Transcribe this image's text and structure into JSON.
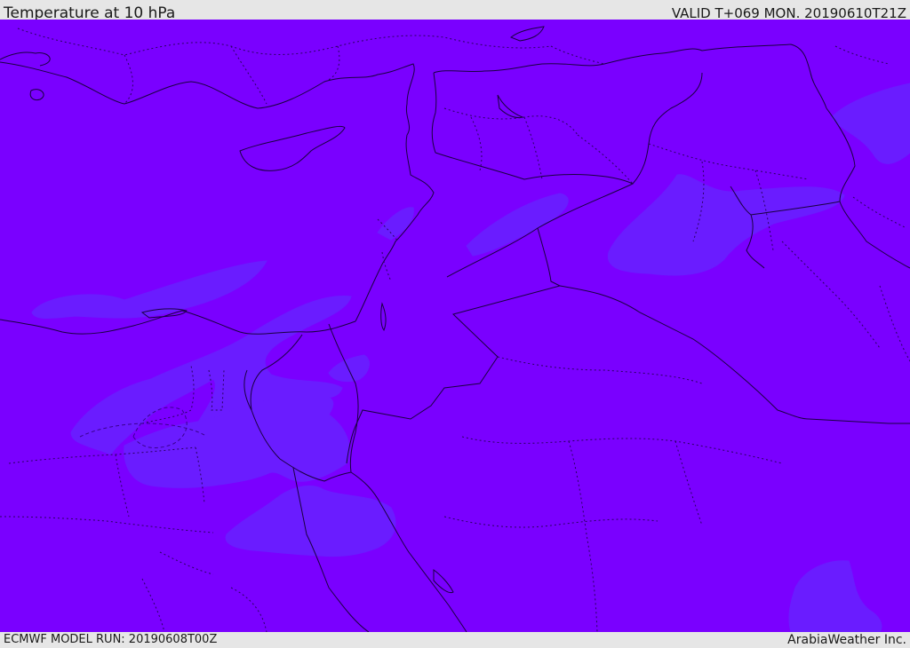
{
  "header": {
    "title": "Temperature at 10 hPa",
    "valid": "VALID T+069 MON. 20190610T21Z"
  },
  "footer": {
    "model_run": "ECMWF MODEL RUN: 20190608T00Z",
    "credit": "ArabiaWeather Inc."
  },
  "map": {
    "background_color": "#7a00ff",
    "contour_color": "#6a1cff"
  }
}
